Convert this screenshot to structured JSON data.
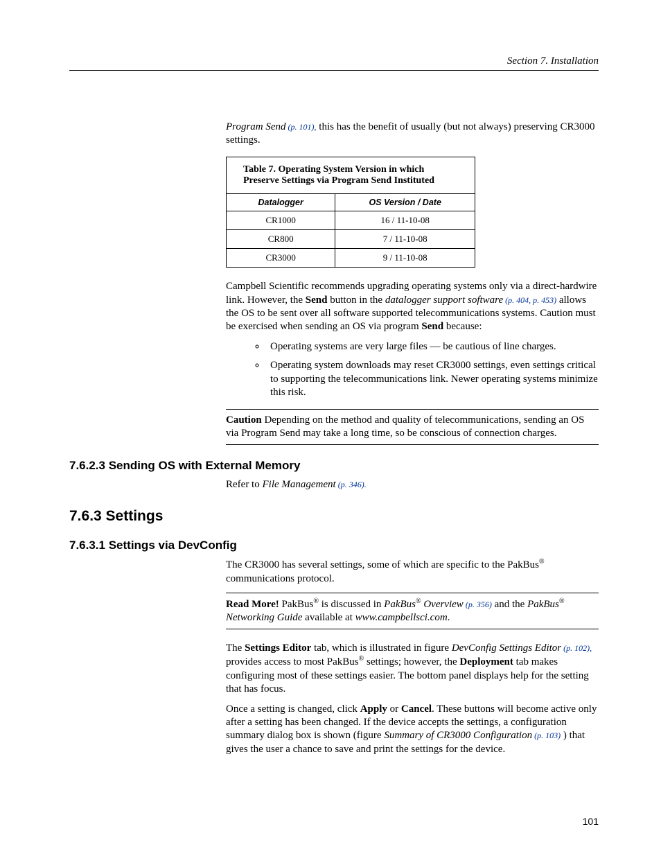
{
  "header": {
    "running": "Section 7.  Installation"
  },
  "intro": {
    "prefix_italic": "Program Send",
    "link1": " (p. 101),",
    "rest": " this has the benefit of usually (but not always) preserving CR3000 settings."
  },
  "table": {
    "title": "Table 7. Operating System Version in which Preserve Settings via Program Send Instituted",
    "col1": "Datalogger",
    "col2": "OS Version / Date",
    "rows": [
      {
        "c1": "CR1000",
        "c2": "16 / 11-10-08"
      },
      {
        "c1": "CR800",
        "c2": "7 / 11-10-08"
      },
      {
        "c1": "CR3000",
        "c2": "9 / 11-10-08"
      }
    ]
  },
  "para2": {
    "a": "Campbell Scientific recommends upgrading operating systems only via a direct-hardwire link.  However, the ",
    "b": "Send",
    "c": " button in the ",
    "d": "datalogger support software",
    "link": " (p. 404, p. 453)",
    "e": " allows the OS to be sent over all software supported telecommunications systems.  Caution must be exercised when sending an OS via program ",
    "f": "Send",
    "g": " because:"
  },
  "bullets": {
    "b1": "Operating systems are very large files — be cautious of line charges.",
    "b2": "Operating system downloads may reset CR3000 settings, even settings critical to supporting the telecommunications link.  Newer operating systems minimize this risk."
  },
  "caution": {
    "label": "Caution",
    "text": "  Depending on the method and quality of telecommunications, sending an OS via Program Send may take a long time, so be conscious of connection charges."
  },
  "h_7623": "7.6.2.3 Sending OS with External Memory",
  "p_7623": {
    "a": "Refer to ",
    "b": "File Management",
    "link": " (p. 346)."
  },
  "h_763": "7.6.3 Settings",
  "h_7631": "7.6.3.1 Settings via DevConfig",
  "p_7631a": "The CR3000 has several settings, some of which are specific to the PakBus",
  "p_7631a2": " communications protocol.",
  "readmore": {
    "label": "Read More!",
    "a": " PakBus",
    "b": " is discussed in ",
    "c": "PakBus",
    "d": " Overview",
    "link": " (p. 356)",
    "e": " and the ",
    "f": "PakBus",
    "g": " Networking Guide",
    "h": " available at ",
    "i": "www.campbellsci.com",
    "j": "."
  },
  "p_editor": {
    "a": "The ",
    "b": "Settings Editor",
    "c": " tab, which is illustrated in figure ",
    "d": "DevConfig Settings Editor",
    "link": " (p. 102),",
    "e": " provides access to most PakBus",
    "f": " settings; however, the ",
    "g": "Deployment",
    "h": " tab makes configuring most of these settings easier.  The bottom panel displays help for the setting that has focus."
  },
  "p_apply": {
    "a": "Once a setting is changed, click ",
    "b": "Apply",
    "c": " or ",
    "d": "Cancel",
    "e": ". These buttons will become active only after a setting has been changed. If the device accepts the settings, a configuration summary dialog box is shown (figure ",
    "f": "Summary of CR3000 Configuration",
    "link": " (p. 103)",
    "g": " ) that gives the user a chance to save and print the settings for the device."
  },
  "page_number": "101",
  "reg": "®"
}
